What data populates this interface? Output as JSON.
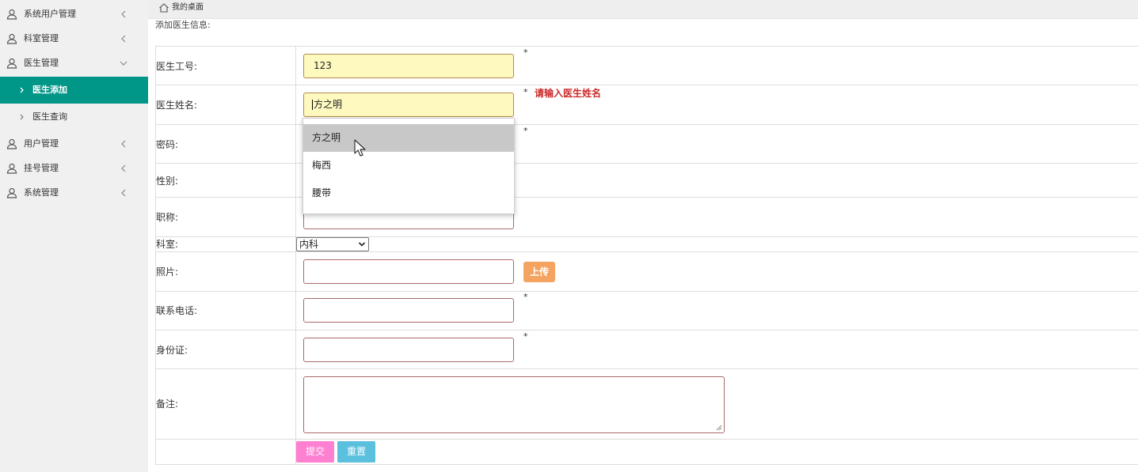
{
  "sidebar": {
    "items": [
      {
        "label": "系统用户管理",
        "icon": "user-icon",
        "expanded": false
      },
      {
        "label": "科室管理",
        "icon": "user-icon",
        "expanded": false
      },
      {
        "label": "医生管理",
        "icon": "user-icon",
        "expanded": true
      },
      {
        "label": "用户管理",
        "icon": "user-icon",
        "expanded": false
      },
      {
        "label": "挂号管理",
        "icon": "user-icon",
        "expanded": false
      },
      {
        "label": "系统管理",
        "icon": "user-icon",
        "expanded": false
      }
    ],
    "sub_items": [
      {
        "label": "医生添加",
        "active": true
      },
      {
        "label": "医生查询",
        "active": false
      }
    ],
    "active_color": "#009688"
  },
  "breadcrumb": {
    "home": "我的桌面"
  },
  "form": {
    "title": "添加医生信息:",
    "labels": {
      "doctor_id": "医生工号:",
      "doctor_name": "医生姓名:",
      "password": "密码:",
      "gender": "性别:",
      "title": "职称:",
      "department": "科室:",
      "photo": "照片:",
      "phone": "联系电话:",
      "id_card": "身份证:",
      "remark": "备注:"
    },
    "values": {
      "doctor_id": "123",
      "doctor_name": "方之明",
      "department": "内科"
    },
    "required_mark": "*",
    "name_error": "请输入医生姓名",
    "upload_label": "上传",
    "submit_label": "提交",
    "reset_label": "重置",
    "colors": {
      "autofill_bg": "#fdf9bf",
      "error": "#cc2a2a",
      "upload": "#f4a460",
      "submit": "#ff7fd0",
      "reset": "#5bc0de"
    }
  },
  "autocomplete": {
    "options": [
      "方之明",
      "梅西",
      "腰带"
    ],
    "highlighted_index": 0
  }
}
